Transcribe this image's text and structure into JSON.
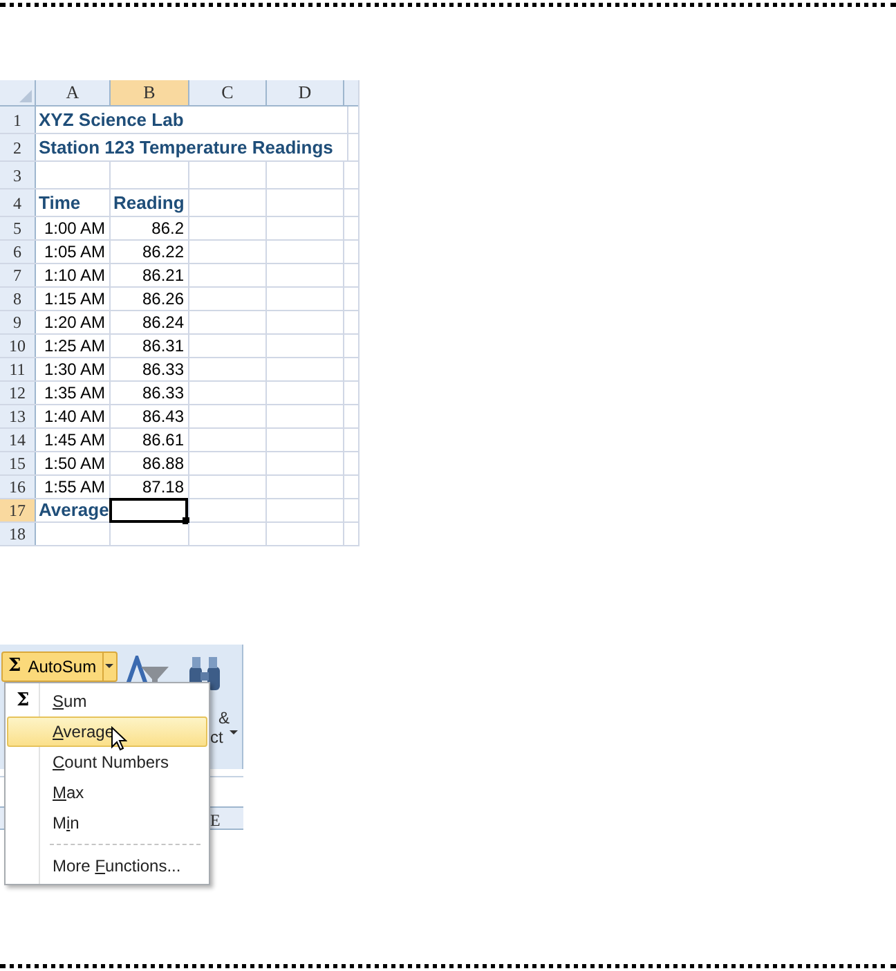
{
  "sheet": {
    "columns": [
      {
        "label": "A",
        "selected": false
      },
      {
        "label": "B",
        "selected": true
      },
      {
        "label": "C",
        "selected": false
      },
      {
        "label": "D",
        "selected": false
      }
    ],
    "rows": [
      {
        "header": "1",
        "selected": false,
        "kind": "title",
        "cells": [
          "XYZ Science Lab"
        ],
        "active_in_b": false
      },
      {
        "header": "2",
        "selected": false,
        "kind": "title",
        "cells": [
          "Station 123 Temperature Readings"
        ],
        "active_in_b": false
      },
      {
        "header": "3",
        "selected": false,
        "kind": "data",
        "cells": [],
        "active_in_b": false
      },
      {
        "header": "4",
        "selected": false,
        "kind": "heading",
        "cells": [
          "Time",
          "Reading"
        ],
        "active_in_b": false
      },
      {
        "header": "5",
        "selected": false,
        "kind": "data",
        "cells": [
          "1:00 AM",
          "86.2"
        ],
        "active_in_b": false
      },
      {
        "header": "6",
        "selected": false,
        "kind": "data",
        "cells": [
          "1:05 AM",
          "86.22"
        ],
        "active_in_b": false
      },
      {
        "header": "7",
        "selected": false,
        "kind": "data",
        "cells": [
          "1:10 AM",
          "86.21"
        ],
        "active_in_b": false
      },
      {
        "header": "8",
        "selected": false,
        "kind": "data",
        "cells": [
          "1:15 AM",
          "86.26"
        ],
        "active_in_b": false
      },
      {
        "header": "9",
        "selected": false,
        "kind": "data",
        "cells": [
          "1:20 AM",
          "86.24"
        ],
        "active_in_b": false
      },
      {
        "header": "10",
        "selected": false,
        "kind": "data",
        "cells": [
          "1:25 AM",
          "86.31"
        ],
        "active_in_b": false
      },
      {
        "header": "11",
        "selected": false,
        "kind": "data",
        "cells": [
          "1:30 AM",
          "86.33"
        ],
        "active_in_b": false
      },
      {
        "header": "12",
        "selected": false,
        "kind": "data",
        "cells": [
          "1:35 AM",
          "86.33"
        ],
        "active_in_b": false
      },
      {
        "header": "13",
        "selected": false,
        "kind": "data",
        "cells": [
          "1:40 AM",
          "86.43"
        ],
        "active_in_b": false
      },
      {
        "header": "14",
        "selected": false,
        "kind": "data",
        "cells": [
          "1:45 AM",
          "86.61"
        ],
        "active_in_b": false
      },
      {
        "header": "15",
        "selected": false,
        "kind": "data",
        "cells": [
          "1:50 AM",
          "86.88"
        ],
        "active_in_b": false
      },
      {
        "header": "16",
        "selected": false,
        "kind": "data",
        "cells": [
          "1:55 AM",
          "87.18"
        ],
        "active_in_b": false
      },
      {
        "header": "17",
        "selected": true,
        "kind": "heading",
        "cells": [
          "Average"
        ],
        "active_in_b": true
      },
      {
        "header": "18",
        "selected": false,
        "kind": "data",
        "cells": [],
        "active_in_b": false
      }
    ]
  },
  "ribbon": {
    "autosum_button": {
      "icon": "Σ",
      "label": "AutoSum"
    },
    "partial_labels": [
      "&",
      "ct"
    ],
    "partial_column": "E",
    "menu": [
      {
        "kind": "item",
        "icon": "Σ",
        "parts": {
          "key": "S",
          "after": "um"
        },
        "selected": false
      },
      {
        "kind": "item",
        "parts": {
          "key": "A",
          "after": "verage"
        },
        "selected": true
      },
      {
        "kind": "item",
        "parts": {
          "key": "C",
          "after": "ount Numbers"
        },
        "selected": false
      },
      {
        "kind": "item",
        "parts": {
          "key": "M",
          "after": "ax"
        },
        "selected": false
      },
      {
        "kind": "item",
        "parts": {
          "before": "M",
          "key": "i",
          "after": "n"
        },
        "selected": false
      },
      {
        "kind": "separator"
      },
      {
        "kind": "item",
        "parts": {
          "before": "More ",
          "key": "F",
          "after": "unctions..."
        },
        "selected": false
      }
    ]
  }
}
